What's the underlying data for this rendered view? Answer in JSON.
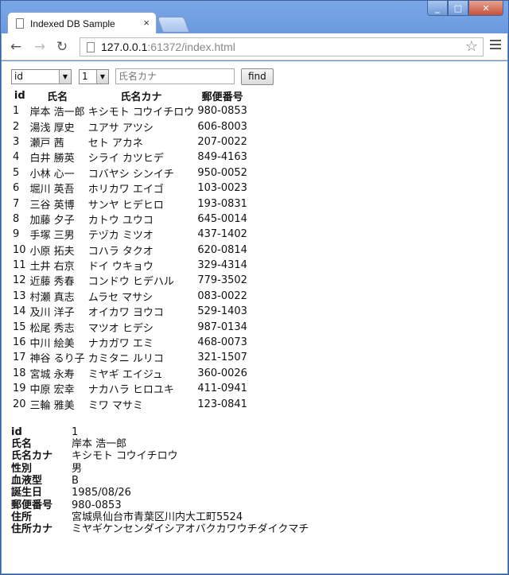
{
  "browser": {
    "tab_title": "Indexed DB Sample",
    "tab_close": "×",
    "url_host": "127.0.0.1",
    "url_rest": ":61372/index.html"
  },
  "controls": {
    "field_select": "id",
    "count_select": "1",
    "search_placeholder": "氏名カナ",
    "find_label": "find"
  },
  "table": {
    "headers": [
      "id",
      "氏名",
      "氏名カナ",
      "郵便番号"
    ],
    "rows": [
      [
        "1",
        "岸本 浩一郎",
        "キシモト コウイチロウ",
        "980-0853"
      ],
      [
        "2",
        "湯浅 厚史",
        "ユアサ アツシ",
        "606-8003"
      ],
      [
        "3",
        "瀬戸 茜",
        "セト アカネ",
        "207-0022"
      ],
      [
        "4",
        "白井 勝英",
        "シライ カツヒデ",
        "849-4163"
      ],
      [
        "5",
        "小林 心一",
        "コバヤシ シンイチ",
        "950-0052"
      ],
      [
        "6",
        "堀川 英吾",
        "ホリカワ エイゴ",
        "103-0023"
      ],
      [
        "7",
        "三谷 英博",
        "サンヤ ヒデヒロ",
        "193-0831"
      ],
      [
        "8",
        "加藤 夕子",
        "カトウ ユウコ",
        "645-0014"
      ],
      [
        "9",
        "手塚 三男",
        "テヅカ ミツオ",
        "437-1402"
      ],
      [
        "10",
        "小原 拓夫",
        "コハラ タクオ",
        "620-0814"
      ],
      [
        "11",
        "土井 右京",
        "ドイ ウキョウ",
        "329-4314"
      ],
      [
        "12",
        "近藤 秀春",
        "コンドウ ヒデハル",
        "779-3502"
      ],
      [
        "13",
        "村瀬 真志",
        "ムラセ マサシ",
        "083-0022"
      ],
      [
        "14",
        "及川 洋子",
        "オイカワ ヨウコ",
        "529-1403"
      ],
      [
        "15",
        "松尾 秀志",
        "マツオ ヒデシ",
        "987-0134"
      ],
      [
        "16",
        "中川 絵美",
        "ナカガワ エミ",
        "468-0073"
      ],
      [
        "17",
        "神谷 るり子",
        "カミタニ ルリコ",
        "321-1507"
      ],
      [
        "18",
        "宮城 永寿",
        "ミヤギ エイジュ",
        "360-0026"
      ],
      [
        "19",
        "中原 宏幸",
        "ナカハラ ヒロユキ",
        "411-0941"
      ],
      [
        "20",
        "三輪 雅美",
        "ミワ マサミ",
        "123-0841"
      ]
    ]
  },
  "detail": [
    {
      "label": "id",
      "value": "1"
    },
    {
      "label": "氏名",
      "value": "岸本 浩一郎"
    },
    {
      "label": "氏名カナ",
      "value": "キシモト コウイチロウ"
    },
    {
      "label": "性別",
      "value": "男"
    },
    {
      "label": "血液型",
      "value": "B"
    },
    {
      "label": "誕生日",
      "value": "1985/08/26"
    },
    {
      "label": "郵便番号",
      "value": "980-0853"
    },
    {
      "label": "住所",
      "value": "宮城県仙台市青葉区川内大工町5524"
    },
    {
      "label": "住所カナ",
      "value": "ミヤギケンセンダイシアオバクカワウチダイクマチ"
    }
  ]
}
